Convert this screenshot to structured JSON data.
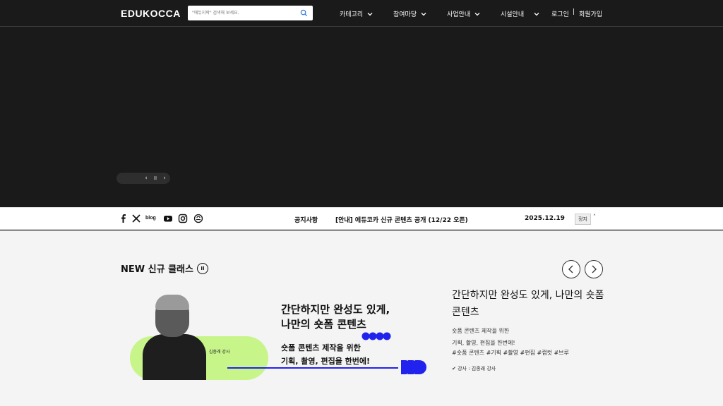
{
  "header": {
    "logo": "EDUKOCCA",
    "search_placeholder": "\"에듀지락\" 검색해 보세요.",
    "nav": [
      {
        "label": "카테고리"
      },
      {
        "label": "참여마당"
      },
      {
        "label": "사업안내"
      },
      {
        "label": "시설안내"
      }
    ],
    "login": "로그인",
    "separator": "|",
    "signup": "회원가입"
  },
  "hero": {
    "prev": "‹",
    "pause": "II",
    "next": "›"
  },
  "notice": {
    "blog": "blog",
    "label": "공지사항",
    "text": "[안내] 에듀코카 신규 콘텐츠 공개 (12/22 오픈)",
    "date": "2025.12.19",
    "stop": "정지",
    "arrow": "˄"
  },
  "section": {
    "title": "NEW 신규 클래스",
    "pause": "II"
  },
  "card": {
    "title": "간단하지만 완성도 있게, 나만의 숏폼 콘텐츠",
    "desc_line1": "숏폼 콘텐츠 제작을 위한",
    "desc_line2": "기획, 촬영, 편집을 한번에!",
    "tags": "#숏폼 콘텐츠 #기획 #촬영 #편집 #캡컷 #브루",
    "teacher": "✔ 강사 : 김종래 강사",
    "thumb_heading_line1": "간단하지만 완성도 있게,",
    "thumb_heading_line2": "나만의 숏폼 콘텐츠",
    "thumb_sub_line1": "숏폼 콘텐츠 제작을 위한",
    "thumb_sub_line2": "기획, 촬영, 편집을 한번에!",
    "thumb_teacher": "김종래 강사"
  },
  "colors": {
    "dark_bg": "#1a1a1a",
    "accent_green": "#c7f58a",
    "accent_blue": "#2222ee"
  }
}
